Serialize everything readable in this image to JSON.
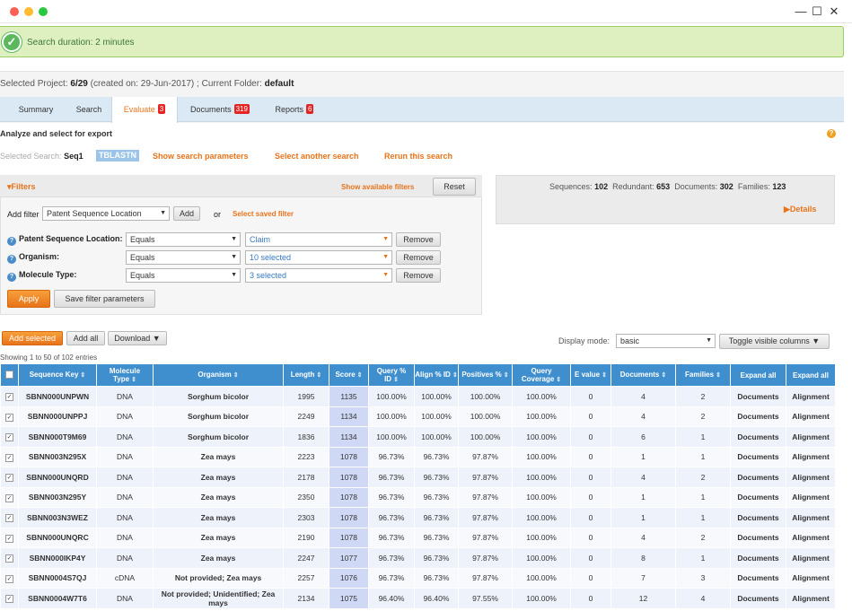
{
  "window": {
    "colors": {
      "close": "#ff5f57",
      "minimize": "#febc2e",
      "maximize": "#28c840"
    },
    "minimize_icon": "—",
    "maximize_icon": "☐",
    "close_icon": "✕"
  },
  "alert": {
    "message": "Search duration: 2 minutes"
  },
  "project": {
    "prefix": "Selected Project:",
    "project": "6/29",
    "created": "(created on: 29-Jun-2017) ; Current Folder:",
    "folder": "default"
  },
  "tabs": [
    {
      "label": "Summary",
      "badge": ""
    },
    {
      "label": "Search",
      "badge": ""
    },
    {
      "label": "Evaluate",
      "badge": "3"
    },
    {
      "label": "Documents",
      "badge": "319"
    },
    {
      "label": "Reports",
      "badge": "6"
    }
  ],
  "analyze": {
    "heading": "Analyze and select for export",
    "help": "?"
  },
  "selected_search": {
    "label": "Selected Search:",
    "name": "Seq1",
    "type": "TBLASTN",
    "show_params": "Show search parameters",
    "select_another": "Select another search",
    "rerun": "Rerun this search"
  },
  "filters": {
    "title": "▾Filters",
    "show_available": "Show available filters",
    "reset": "Reset",
    "add_filter_label": "Add filter",
    "add_filter_value": "Patent Sequence Location",
    "add": "Add",
    "or": "or",
    "select_saved": "Select saved filter",
    "rows": [
      {
        "label": "Patent Sequence Location:",
        "op": "Equals",
        "value": "Claim",
        "remove": "Remove"
      },
      {
        "label": "Organism:",
        "op": "Equals",
        "value": "10 selected",
        "remove": "Remove"
      },
      {
        "label": "Molecule Type:",
        "op": "Equals",
        "value": "3 selected",
        "remove": "Remove"
      }
    ],
    "apply": "Apply",
    "save": "Save filter parameters"
  },
  "stats": {
    "seq_label": "Sequences:",
    "seq": "102",
    "red_label": "Redundant:",
    "red": "653",
    "doc_label": "Documents:",
    "doc": "302",
    "fam_label": "Families:",
    "fam": "123",
    "details": "▶Details"
  },
  "actions": {
    "add_selected": "Add selected",
    "add_all": "Add all",
    "download": "Download ▼",
    "display_mode_label": "Display mode:",
    "display_mode": "basic",
    "toggle": "Toggle visible columns ▼"
  },
  "showing": "Showing 1 to 50 of 102 entries",
  "table": {
    "headers": [
      "Sequence Key",
      "Molecule Type",
      "Organism",
      "Length",
      "Score",
      "Query % ID",
      "Align % ID",
      "Positives %",
      "Query Coverage",
      "E value",
      "Documents",
      "Families",
      "Expand all",
      "Expand all"
    ],
    "rows": [
      {
        "key": "SBNN000UNPWN",
        "mol": "DNA",
        "org": "Sorghum bicolor",
        "len": "1995",
        "score": "1135",
        "qid": "100.00%",
        "aid": "100.00%",
        "pos": "100.00%",
        "cov": "100.00%",
        "ev": "0",
        "docs": "4",
        "fam": "2",
        "l1": "Documents",
        "l2": "Alignment"
      },
      {
        "key": "SBNN000UNPPJ",
        "mol": "DNA",
        "org": "Sorghum bicolor",
        "len": "2249",
        "score": "1134",
        "qid": "100.00%",
        "aid": "100.00%",
        "pos": "100.00%",
        "cov": "100.00%",
        "ev": "0",
        "docs": "4",
        "fam": "2",
        "l1": "Documents",
        "l2": "Alignment"
      },
      {
        "key": "SBNN000T9M69",
        "mol": "DNA",
        "org": "Sorghum bicolor",
        "len": "1836",
        "score": "1134",
        "qid": "100.00%",
        "aid": "100.00%",
        "pos": "100.00%",
        "cov": "100.00%",
        "ev": "0",
        "docs": "6",
        "fam": "1",
        "l1": "Documents",
        "l2": "Alignment"
      },
      {
        "key": "SBNN003N295X",
        "mol": "DNA",
        "org": "Zea mays",
        "len": "2223",
        "score": "1078",
        "qid": "96.73%",
        "aid": "96.73%",
        "pos": "97.87%",
        "cov": "100.00%",
        "ev": "0",
        "docs": "1",
        "fam": "1",
        "l1": "Documents",
        "l2": "Alignment"
      },
      {
        "key": "SBNN000UNQRD",
        "mol": "DNA",
        "org": "Zea mays",
        "len": "2178",
        "score": "1078",
        "qid": "96.73%",
        "aid": "96.73%",
        "pos": "97.87%",
        "cov": "100.00%",
        "ev": "0",
        "docs": "4",
        "fam": "2",
        "l1": "Documents",
        "l2": "Alignment"
      },
      {
        "key": "SBNN003N295Y",
        "mol": "DNA",
        "org": "Zea mays",
        "len": "2350",
        "score": "1078",
        "qid": "96.73%",
        "aid": "96.73%",
        "pos": "97.87%",
        "cov": "100.00%",
        "ev": "0",
        "docs": "1",
        "fam": "1",
        "l1": "Documents",
        "l2": "Alignment"
      },
      {
        "key": "SBNN003N3WEZ",
        "mol": "DNA",
        "org": "Zea mays",
        "len": "2303",
        "score": "1078",
        "qid": "96.73%",
        "aid": "96.73%",
        "pos": "97.87%",
        "cov": "100.00%",
        "ev": "0",
        "docs": "1",
        "fam": "1",
        "l1": "Documents",
        "l2": "Alignment"
      },
      {
        "key": "SBNN000UNQRC",
        "mol": "DNA",
        "org": "Zea mays",
        "len": "2190",
        "score": "1078",
        "qid": "96.73%",
        "aid": "96.73%",
        "pos": "97.87%",
        "cov": "100.00%",
        "ev": "0",
        "docs": "4",
        "fam": "2",
        "l1": "Documents",
        "l2": "Alignment"
      },
      {
        "key": "SBNN000IKP4Y",
        "mol": "DNA",
        "org": "Zea mays",
        "len": "2247",
        "score": "1077",
        "qid": "96.73%",
        "aid": "96.73%",
        "pos": "97.87%",
        "cov": "100.00%",
        "ev": "0",
        "docs": "8",
        "fam": "1",
        "l1": "Documents",
        "l2": "Alignment"
      },
      {
        "key": "SBNN0004S7QJ",
        "mol": "cDNA",
        "org": "Not provided; Zea mays",
        "len": "2257",
        "score": "1076",
        "qid": "96.73%",
        "aid": "96.73%",
        "pos": "97.87%",
        "cov": "100.00%",
        "ev": "0",
        "docs": "7",
        "fam": "3",
        "l1": "Documents",
        "l2": "Alignment"
      },
      {
        "key": "SBNN0004W7T6",
        "mol": "DNA",
        "org": "Not provided; Unidentified; Zea mays",
        "len": "2134",
        "score": "1075",
        "qid": "96.40%",
        "aid": "96.40%",
        "pos": "97.55%",
        "cov": "100.00%",
        "ev": "0",
        "docs": "12",
        "fam": "4",
        "l1": "Documents",
        "l2": "Alignment"
      }
    ]
  }
}
